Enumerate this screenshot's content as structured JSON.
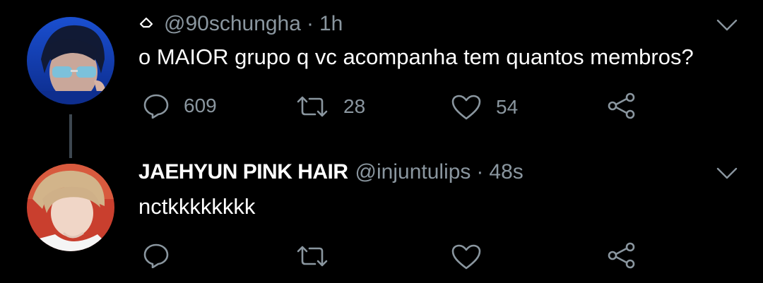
{
  "tweets": [
    {
      "retweet_marker_icon": "home-outline-icon",
      "handle": "@90schungha",
      "separator": "·",
      "time": "1h",
      "text": "o MAIOR grupo q vc acompanha tem quantos membros?",
      "actions": {
        "reply": {
          "icon": "reply-icon",
          "count": "609"
        },
        "retweet": {
          "icon": "retweet-icon",
          "count": "28"
        },
        "like": {
          "icon": "heart-icon",
          "count": "54"
        },
        "share": {
          "icon": "share-icon"
        }
      },
      "menu_icon": "chevron-down-icon"
    },
    {
      "name": "JAEHYUN PINK HAIR",
      "handle": "@injuntulips",
      "separator": "·",
      "time": "48s",
      "text": "nctkkkkkkkk",
      "actions": {
        "reply": {
          "icon": "reply-icon"
        },
        "retweet": {
          "icon": "retweet-icon"
        },
        "like": {
          "icon": "heart-icon"
        },
        "share": {
          "icon": "share-icon"
        }
      },
      "menu_icon": "chevron-down-icon"
    }
  ],
  "colors": {
    "background": "#000000",
    "primary_text": "#ffffff",
    "secondary_text": "#8a969f",
    "thread_line": "#3d4750"
  }
}
